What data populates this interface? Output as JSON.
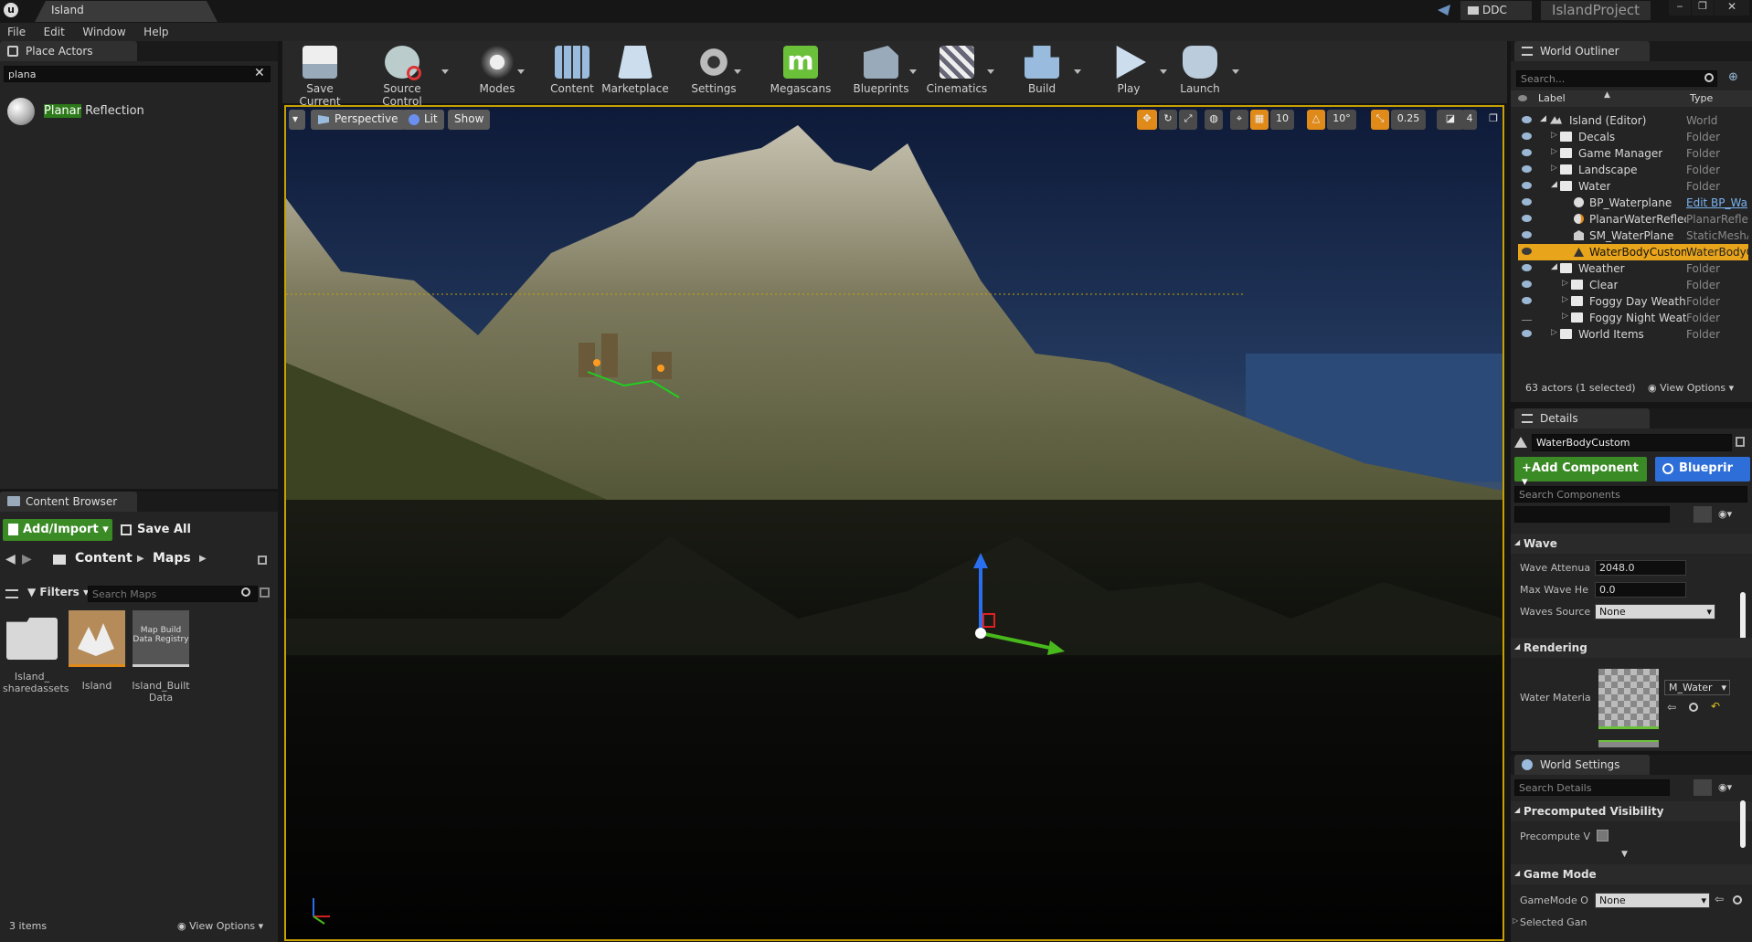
{
  "window": {
    "tab_title": "Island",
    "ddc_label": "DDC",
    "project_name": "IslandProject"
  },
  "menu": [
    "File",
    "Edit",
    "Window",
    "Help"
  ],
  "place_actors": {
    "tab_label": "Place Actors",
    "search_value": "plana",
    "results": [
      {
        "highlight": "Planar",
        "rest": " Reflection"
      }
    ]
  },
  "toolbar": {
    "buttons": [
      "Save Current",
      "Source Control",
      "Modes",
      "Content",
      "Marketplace",
      "Settings",
      "Megascans",
      "Blueprints",
      "Cinematics",
      "Build",
      "Play",
      "Launch"
    ]
  },
  "viewport": {
    "perspective_label": "Perspective",
    "lit_label": "Lit",
    "show_label": "Show",
    "grid_snap": "10",
    "rotation_snap": "10°",
    "scale_snap": "0.25",
    "camera_speed": "4"
  },
  "content_browser": {
    "tab_label": "Content Browser",
    "add_import_label": "Add/Import",
    "save_all_label": "Save All",
    "path": [
      "Content",
      "Maps"
    ],
    "filters_label": "Filters",
    "search_placeholder": "Search Maps",
    "items": [
      {
        "name": "Island_\nsharedassets",
        "kind": "folder"
      },
      {
        "name": "Island",
        "kind": "map"
      },
      {
        "name": "Island_Built\nData",
        "kind": "registry",
        "thumb_text": "Map Build\nData Registry"
      }
    ],
    "item_count": "3 items",
    "view_options_label": "View Options"
  },
  "world_outliner": {
    "tab_label": "World Outliner",
    "search_placeholder": "Search...",
    "col_label": "Label",
    "col_type": "Type",
    "rows": [
      {
        "label": "Island (Editor)",
        "type": "World"
      },
      {
        "label": "Decals",
        "type": "Folder"
      },
      {
        "label": "Game Manager",
        "type": "Folder"
      },
      {
        "label": "Landscape",
        "type": "Folder"
      },
      {
        "label": "Water",
        "type": "Folder"
      },
      {
        "label": "BP_Waterplane",
        "type": "Edit BP_Wa"
      },
      {
        "label": "PlanarWaterReflec",
        "type": "PlanarRefle"
      },
      {
        "label": "SM_WaterPlane",
        "type": "StaticMeshA"
      },
      {
        "label": "WaterBodyCustom",
        "type": "WaterBodyC"
      },
      {
        "label": "Weather",
        "type": "Folder"
      },
      {
        "label": "Clear",
        "type": "Folder"
      },
      {
        "label": "Foggy Day Weathe",
        "type": "Folder"
      },
      {
        "label": "Foggy Night Weath",
        "type": "Folder"
      },
      {
        "label": "World Items",
        "type": "Folder"
      }
    ],
    "actor_count": "63 actors (1 selected)",
    "view_options_label": "View Options"
  },
  "details": {
    "tab_label": "Details",
    "actor_name": "WaterBodyCustom",
    "add_component_label": "Add Component",
    "blueprint_label": "Blueprir",
    "search_components_placeholder": "Search Components",
    "search_details_placeholder": "Search Details",
    "wave_section": "Wave",
    "wave_props": [
      {
        "name": "Wave Attenua",
        "value": "2048.0"
      },
      {
        "name": "Max Wave He",
        "value": "0.0"
      },
      {
        "name": "Waves Source",
        "value": "None"
      }
    ],
    "rendering_section": "Rendering",
    "water_material_label": "Water Materia",
    "water_material_value": "M_Water"
  },
  "world_settings": {
    "tab_label": "World Settings",
    "search_placeholder": "Search Details",
    "precomputed_section": "Precomputed Visibility",
    "precompute_label": "Precompute V",
    "game_mode_section": "Game Mode",
    "gamemode_label": "GameMode O",
    "gamemode_value": "None",
    "selected_label": "Selected Gan"
  }
}
